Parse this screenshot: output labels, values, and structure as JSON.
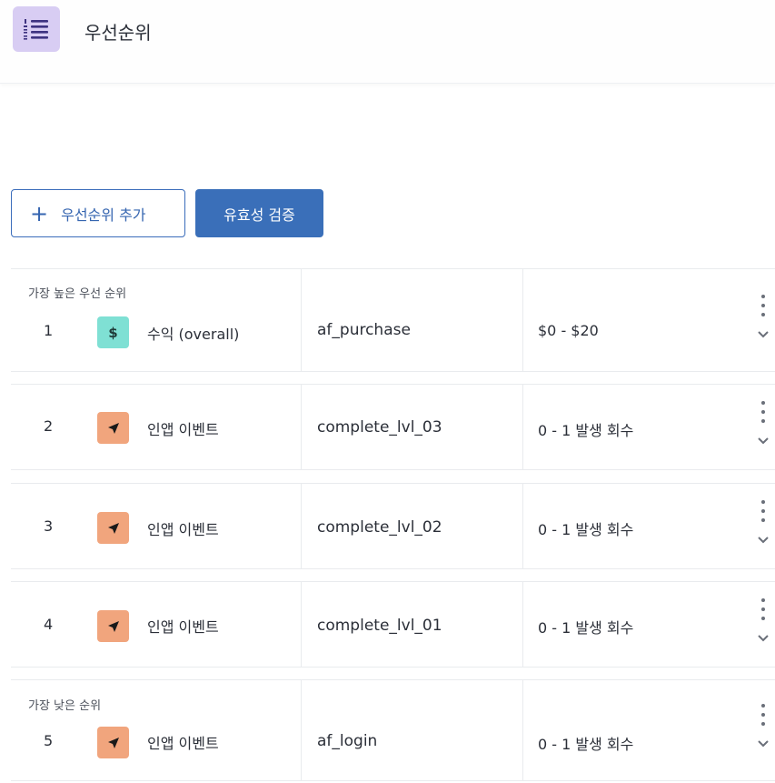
{
  "header": {
    "icon": "list-numbered-icon",
    "title": "우선순위"
  },
  "toolbar": {
    "add_label": "우선순위 추가",
    "validate_label": "유효성 검증"
  },
  "colors": {
    "accent": "#3a6fb9",
    "header_icon_bg": "#d8cdf3",
    "revenue_icon_bg": "#7fe0d4",
    "event_icon_bg": "#f1a57d"
  },
  "rows": [
    {
      "rank_label": "가장 높은 우선 순위",
      "rank": "1",
      "icon": "dollar-icon",
      "icon_text": "$",
      "type": "수익 (overall)",
      "event": "af_purchase",
      "range": "$0 - $20"
    },
    {
      "rank_label": "",
      "rank": "2",
      "icon": "navigation-arrow-icon",
      "type": "인앱 이벤트",
      "event": "complete_lvl_03",
      "range": "0 - 1 발생 회수"
    },
    {
      "rank_label": "",
      "rank": "3",
      "icon": "navigation-arrow-icon",
      "type": "인앱 이벤트",
      "event": "complete_lvl_02",
      "range": "0 - 1 발생 회수"
    },
    {
      "rank_label": "",
      "rank": "4",
      "icon": "navigation-arrow-icon",
      "type": "인앱 이벤트",
      "event": "complete_lvl_01",
      "range": "0 - 1 발생 회수"
    },
    {
      "rank_label": "가장 낮은 순위",
      "rank": "5",
      "icon": "navigation-arrow-icon",
      "type": "인앱 이벤트",
      "event": "af_login",
      "range": "0 - 1 발생 회수"
    }
  ]
}
